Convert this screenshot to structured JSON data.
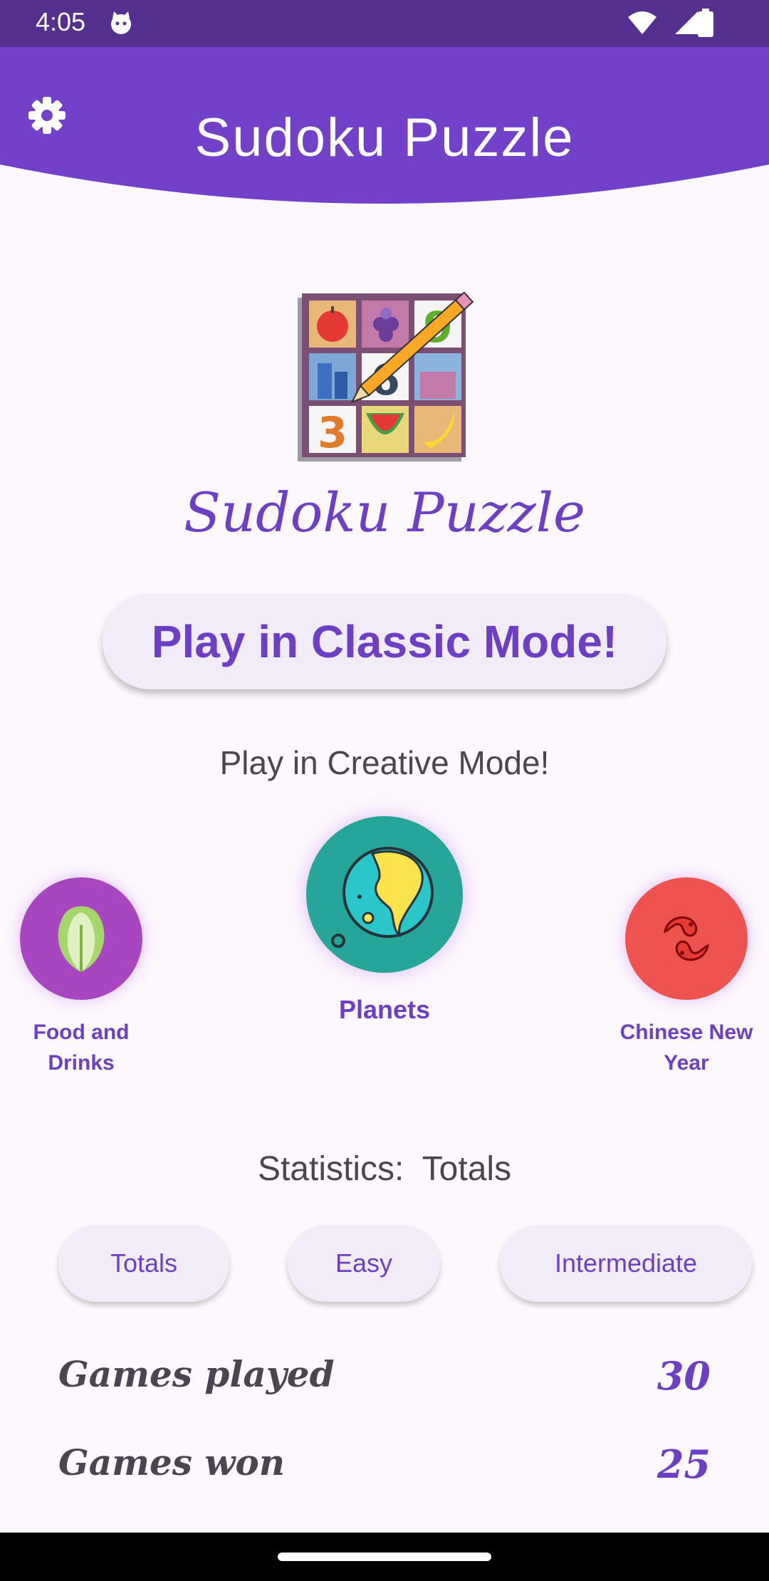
{
  "status_bar": {
    "time": "4:05",
    "icons": [
      "cat-notification-icon",
      "wifi-icon",
      "signal-icon",
      "battery-icon"
    ]
  },
  "header": {
    "title": "Sudoku Puzzle",
    "settings_icon": "gear-icon"
  },
  "logo": {
    "text": "Sudoku Puzzle",
    "grid_tiles": [
      "apple",
      "grapes",
      "9",
      "city",
      "6",
      "city",
      "3",
      "watermelon",
      "banana"
    ]
  },
  "classic_button": {
    "label": "Play in Classic Mode!"
  },
  "creative": {
    "label": "Play in Creative Mode!",
    "themes": [
      {
        "label": "Food and Drinks",
        "icon": "lettuce-icon",
        "color": "#a746c0"
      },
      {
        "label": "Planets",
        "icon": "planet-icon",
        "color": "#26a69a"
      },
      {
        "label": "Chinese New Year",
        "icon": "koi-fish-icon",
        "color": "#ef5350"
      }
    ]
  },
  "statistics": {
    "label": "Statistics:",
    "selected": "Totals",
    "tabs": [
      "Totals",
      "Easy",
      "Intermediate"
    ],
    "rows": [
      {
        "name": "Games played",
        "value": "30"
      },
      {
        "name": "Games won",
        "value": "25"
      }
    ]
  },
  "colors": {
    "primary": "#7340c9",
    "status_bar": "#55308f",
    "accent_text": "#6c3fc4",
    "background": "#fdf8fd"
  }
}
